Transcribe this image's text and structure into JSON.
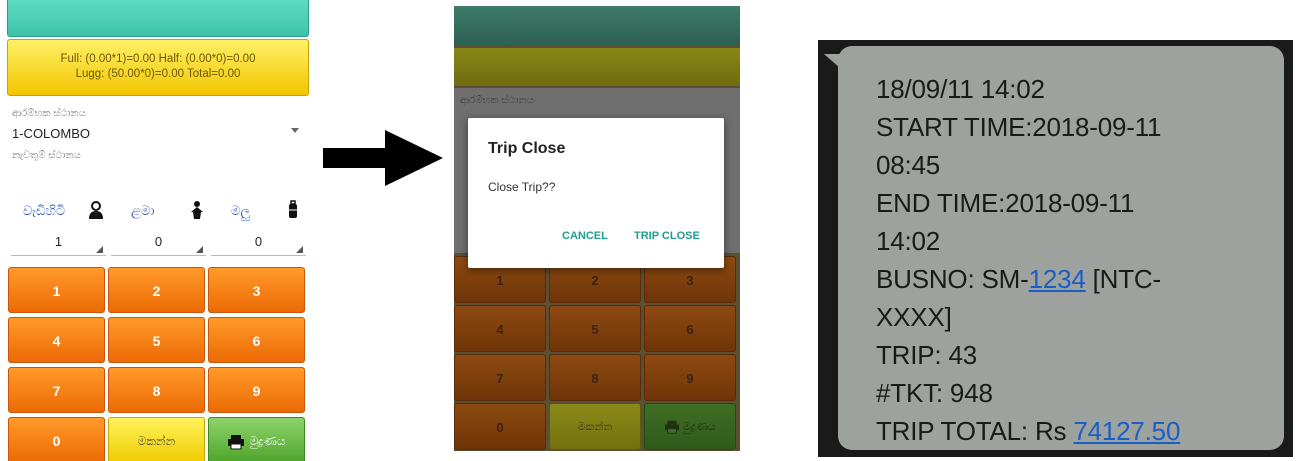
{
  "panel1": {
    "fare_line1": "Full: (0.00*1)=0.00  Half: (0.00*0)=0.00",
    "fare_line2": "Lugg: (50.00*0)=0.00  Total=0.00",
    "start_label": "ආරම්භක ස්ථානය",
    "route": "1-COLOMBO",
    "end_label": "නැවතුම් ස්ථානය",
    "categories": [
      "වැඩිහිටි",
      "ළමා",
      "මලු"
    ],
    "counts": [
      "1",
      "0",
      "0"
    ],
    "keys": [
      "1",
      "2",
      "3",
      "4",
      "5",
      "6",
      "7",
      "8",
      "9",
      "0"
    ],
    "delete_label": "මකන්න",
    "print_label": "මුද්‍රණය"
  },
  "panel2": {
    "label": "ආරම්භක ස්ථානය",
    "keys": [
      "1",
      "2",
      "3",
      "4",
      "5",
      "6",
      "7",
      "8",
      "9",
      "0"
    ],
    "delete_label": "මකන්න",
    "print_label": "මුද්‍රණය",
    "dialog": {
      "title": "Trip Close",
      "message": "Close Trip??",
      "cancel": "CANCEL",
      "confirm": "TRIP CLOSE"
    }
  },
  "panel3": {
    "line1": "18/09/11 14:02",
    "line2": "START TIME:2018-09-11",
    "line3": "08:45",
    "line4": "END TIME:2018-09-11",
    "line5": "14:02",
    "busno_prefix": "BUSNO: SM-",
    "busno_link": "1234",
    "busno_suffix": " [NTC-",
    "line7": "XXXX]",
    "line8": "TRIP: 43",
    "line9": "#TKT: 948",
    "total_prefix": "TRIP TOTAL: Rs ",
    "total_link": "74127.50"
  },
  "colors": {
    "orange_key": "#ec6a05",
    "yellow_key": "#f0cc00",
    "green_key": "#4fa52c",
    "teal_bar": "#3cc2a8",
    "dialog_action": "#1e9e8c",
    "sms_bubble": "#9ea29e",
    "link": "#1a5fc8"
  },
  "icons": [
    "adult-person-icon",
    "child-person-icon",
    "luggage-icon",
    "printer-icon",
    "dropdown-arrow-icon",
    "right-arrow-icon"
  ]
}
